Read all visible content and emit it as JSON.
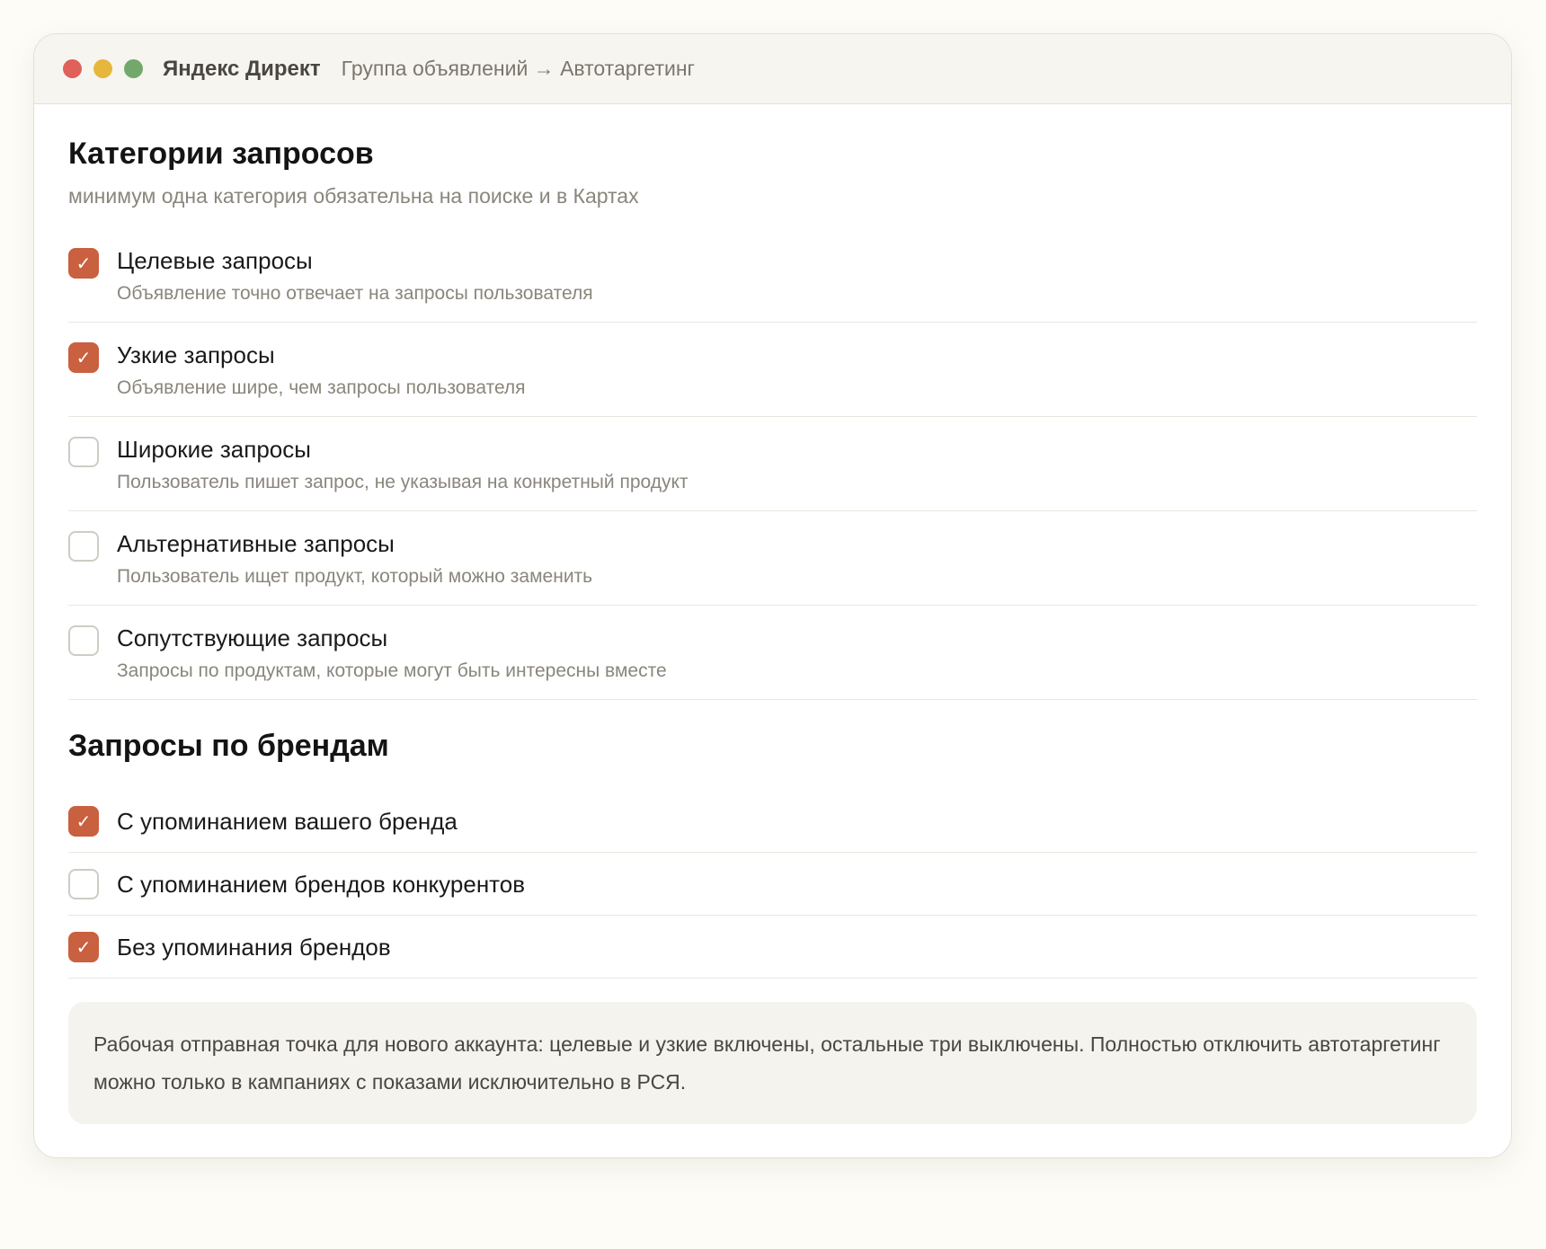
{
  "window": {
    "app_name": "Яндекс Директ",
    "breadcrumb": "Группа объявлений → Автотаргетинг"
  },
  "categories": {
    "title": "Категории запросов",
    "subtitle": "минимум одна категория обязательна на поиске и в Картах",
    "items": [
      {
        "label": "Целевые запросы",
        "description": "Объявление точно отвечает на запросы пользователя",
        "checked": true
      },
      {
        "label": "Узкие запросы",
        "description": "Объявление шире, чем запросы пользователя",
        "checked": true
      },
      {
        "label": "Широкие запросы",
        "description": "Пользователь пишет запрос, не указывая на конкретный продукт",
        "checked": false
      },
      {
        "label": "Альтернативные запросы",
        "description": "Пользователь ищет продукт, который можно заменить",
        "checked": false
      },
      {
        "label": "Сопутствующие запросы",
        "description": "Запросы по продуктам, которые могут быть интересны вместе",
        "checked": false
      }
    ]
  },
  "brands": {
    "title": "Запросы по брендам",
    "items": [
      {
        "label": "С упоминанием вашего бренда",
        "checked": true
      },
      {
        "label": "С упоминанием брендов конкурентов",
        "checked": false
      },
      {
        "label": "Без упоминания брендов",
        "checked": true
      }
    ]
  },
  "note": "Рабочая отправная точка для нового аккаунта: целевые и узкие включены, остальные три выключены. Полностью отключить автотаргетинг можно только в кампаниях с показами исключительно в РСЯ.",
  "check_glyph": "✓",
  "colors": {
    "accent": "#c9603f",
    "page_background": "#fdfcf7",
    "titlebar": "#f6f5f0"
  }
}
